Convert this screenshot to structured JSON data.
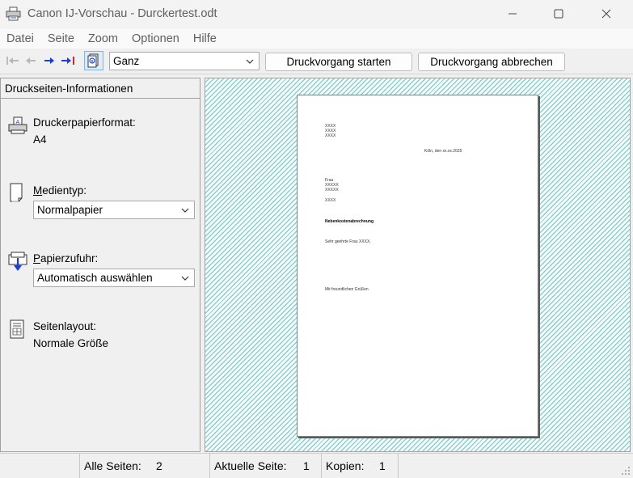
{
  "window": {
    "title": "Canon IJ-Vorschau - Durckertest.odt"
  },
  "menu": [
    "Datei",
    "Seite",
    "Zoom",
    "Optionen",
    "Hilfe"
  ],
  "toolbar": {
    "zoom_value": "Ganz",
    "start_label": "Druckvorgang starten",
    "cancel_label": "Druckvorgang abbrechen"
  },
  "panel": {
    "header": "Druckseiten-Informationen",
    "paper_format_label": "Druckerpapierformat:",
    "paper_format_value": "A4",
    "media_type_label_u": "M",
    "media_type_label_rest": "edientyp:",
    "media_type_value": "Normalpapier",
    "paper_source_label_u": "P",
    "paper_source_label_rest": "apierzufuhr:",
    "paper_source_value": "Automatisch auswählen",
    "layout_label": "Seitenlayout:",
    "layout_value": "Normale Größe"
  },
  "document": {
    "sender": [
      "XXXX",
      "XXXX",
      "XXXX"
    ],
    "date_line": "Köln, den xx.xx.2025",
    "recipient": [
      "Frau",
      "XXXXX",
      "XXXXX"
    ],
    "recipient_extra": "XXXX",
    "subject": "Nebenkostenabrechnung",
    "salutation": "Sehr geehrte Frau XXXX,",
    "closing": "Mit freundlichen Grüßen"
  },
  "status": {
    "all_pages_label": "Alle Seiten:",
    "all_pages_value": "2",
    "current_page_label": "Aktuelle Seite:",
    "current_page_value": "1",
    "copies_label": "Kopien:",
    "copies_value": "1"
  },
  "colors": {
    "preview_hatch": "#7fd3d3",
    "arrow_blue": "#1a3fd8"
  }
}
